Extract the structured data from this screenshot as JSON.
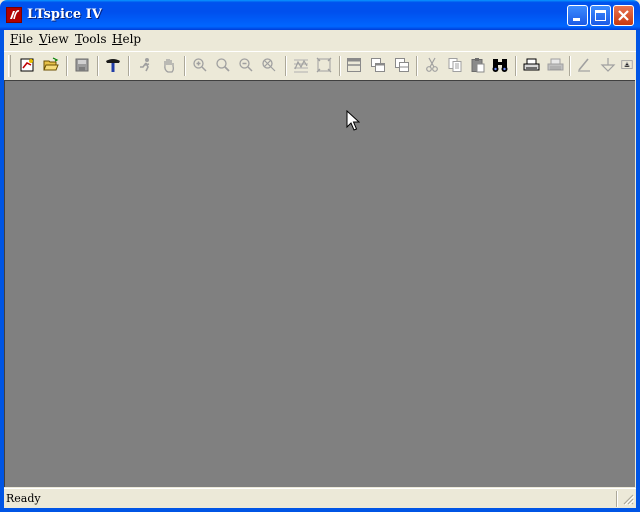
{
  "window": {
    "title": "LTspice IV",
    "app_icon": "ltspice-logo-icon",
    "controls": [
      "minimize-icon",
      "maximize-icon",
      "close-icon"
    ]
  },
  "menu": {
    "file": {
      "acc": "F",
      "rest": "ile"
    },
    "view": {
      "acc": "V",
      "rest": "iew"
    },
    "tools": {
      "acc": "T",
      "rest": "ools"
    },
    "help": {
      "acc": "H",
      "rest": "elp"
    }
  },
  "toolbar": {
    "tools": [
      {
        "name": "new-schematic-icon",
        "enabled": true
      },
      {
        "name": "open-folder-icon",
        "enabled": true
      },
      {
        "name": "save-icon",
        "enabled": false
      },
      {
        "name": "control-panel-hammer-icon",
        "enabled": true
      },
      {
        "name": "run-simulation-icon",
        "enabled": false
      },
      {
        "name": "pan-hand-icon",
        "enabled": false
      },
      {
        "name": "zoom-in-icon",
        "enabled": false
      },
      {
        "name": "zoom-area-icon",
        "enabled": false
      },
      {
        "name": "zoom-out-icon",
        "enabled": false
      },
      {
        "name": "zoom-fit-icon",
        "enabled": false
      },
      {
        "name": "autorange-icon",
        "enabled": false
      },
      {
        "name": "fit-window-icon",
        "enabled": false
      },
      {
        "name": "tile-horizontal-icon",
        "enabled": false
      },
      {
        "name": "cascade-icon",
        "enabled": false
      },
      {
        "name": "tile-vertical-icon",
        "enabled": false
      },
      {
        "name": "cut-scissors-icon",
        "enabled": false
      },
      {
        "name": "copy-icon",
        "enabled": false
      },
      {
        "name": "paste-icon",
        "enabled": false
      },
      {
        "name": "find-binoculars-icon",
        "enabled": true
      },
      {
        "name": "print-preview-icon",
        "enabled": true
      },
      {
        "name": "print-icon",
        "enabled": false
      },
      {
        "name": "draw-wire-icon",
        "enabled": false
      },
      {
        "name": "ground-icon",
        "enabled": false
      },
      {
        "name": "label-net-icon",
        "enabled": false
      }
    ]
  },
  "status": {
    "text": "Ready"
  },
  "colors": {
    "titlebar": "#0054e3",
    "workspace": "#808080",
    "chrome": "#ece9d8"
  }
}
